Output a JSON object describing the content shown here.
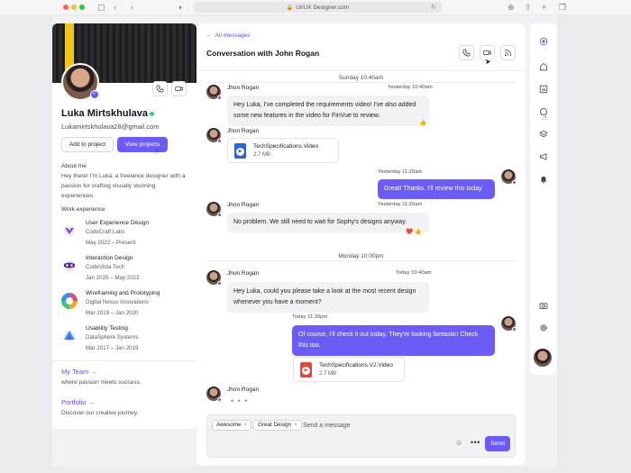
{
  "browser": {
    "url": "UI/UX Designer.com"
  },
  "profile": {
    "name": "Luka Mirtskhulava",
    "email": "Lukamirtskhulava28@gmail.com",
    "add_label": "Add to project",
    "view_label": "View projects",
    "about_heading": "About me",
    "about_text": "Hey there! I'm Luka, a freelance designer with a passion for crafting visually stunning experiences.",
    "work_heading": "Work experience",
    "work": [
      {
        "title": "User Experience Design",
        "company": "CodeCraft Labs",
        "dates": "May 2022 – Present",
        "color": "#7b4dd6"
      },
      {
        "title": "Interaction Design",
        "company": "CodeVista Tech",
        "dates": "Jan 2020 – May 2022",
        "color": "#5a2a8a"
      },
      {
        "title": "Wireframing and Prototyping",
        "company": "Digital Nexus Innovations",
        "dates": "Mar 2019 – Jan 2020",
        "color": "#e04a8a"
      },
      {
        "title": "Usability Testing",
        "company": "DataSphere Systems",
        "dates": "Mar 2017 – Jan 2019",
        "color": "#3a8ee6"
      }
    ],
    "team_link": "My Team",
    "team_sub": "where passion meets success.",
    "portfolio_link": "Portfolio",
    "portfolio_sub": "Discover our creative journey."
  },
  "chat": {
    "back_label": "All messages",
    "title": "Conversation with John Rogan",
    "day1": "Sunday 10:40am",
    "day2": "Monday 10:00pm",
    "messages": [
      {
        "sender": "Jhon Rogan",
        "time": "Yesterday 10:40am",
        "text": "Hey Luka, I've completed the requirements video! I've also added some new features in the video for FinVue to review.",
        "reaction": "👍"
      },
      {
        "sender": "Jhon Rogan",
        "file_name": "TechSpecifications.Video",
        "file_size": "2.7 MB"
      },
      {
        "time": "Yesterday 11:20am",
        "text": "Great! Thanks. I'll review this today"
      },
      {
        "sender": "Jhon Rogan",
        "time": "Yesterday 11:20am",
        "text": "No problem, We still need to wait for Sophy's designs anyway.",
        "reaction": "❤️  👍"
      },
      {
        "sender": "Jhon Rogan",
        "time": "Today 10:40am",
        "text": "Hey Luka, could you please take a look at the most recent design whenever you have a moment?"
      },
      {
        "time": "Today 11:30pm",
        "text": "Of course, I'll check it out today. They're looking fantastic! Check this too.",
        "file_name": "TechSpecifications.V2.Video",
        "file_size": "2.7 MB"
      },
      {
        "sender": "Jhon Rogan",
        "typing": "• • •"
      }
    ]
  },
  "composer": {
    "tags": [
      "Awesome",
      "Great Design"
    ],
    "placeholder": "Send a message",
    "send_label": "Send"
  },
  "colors": {
    "accent": "#6a5cf5",
    "online": "#2ecc71"
  }
}
